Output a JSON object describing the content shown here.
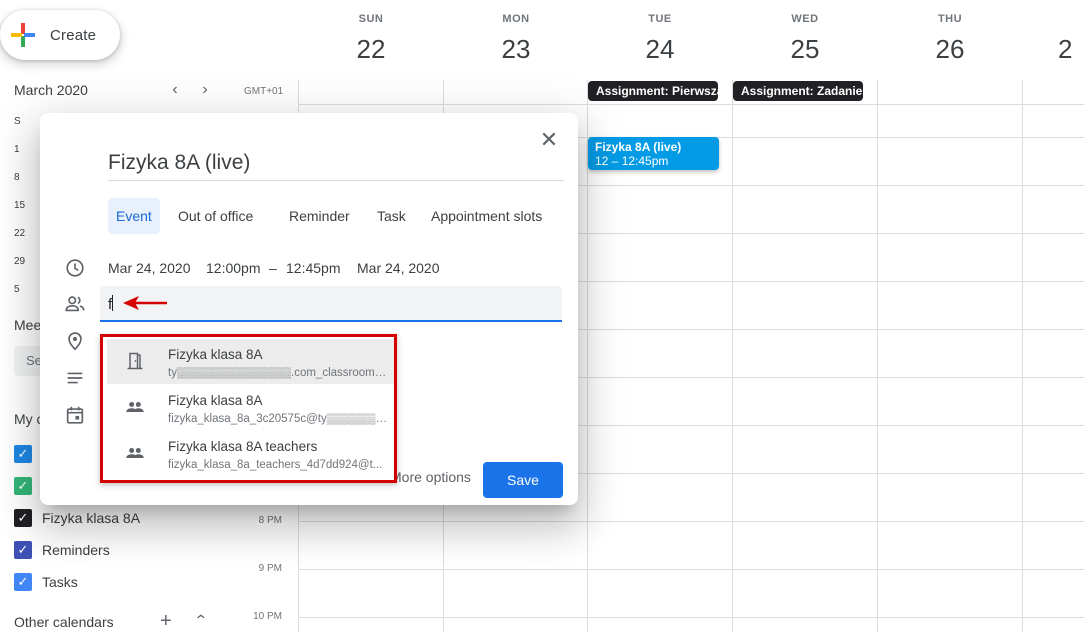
{
  "create": {
    "label": "Create"
  },
  "mini_calendar": {
    "month": "March 2020",
    "weekday_header": "S",
    "rows": [
      "1",
      "8",
      "15",
      "22",
      "29",
      "5"
    ]
  },
  "timezone": "GMT+01",
  "days": [
    {
      "name": "SUN",
      "num": "22"
    },
    {
      "name": "MON",
      "num": "23"
    },
    {
      "name": "TUE",
      "num": "24"
    },
    {
      "name": "WED",
      "num": "25"
    },
    {
      "name": "THU",
      "num": "26"
    }
  ],
  "allday_events": [
    "Assignment: Pierwsza",
    "Assignment: Zadanie"
  ],
  "event": {
    "title": "Fizyka 8A (live)",
    "time": "12 – 12:45pm"
  },
  "time_labels": [
    "8 PM",
    "9 PM",
    "10 PM"
  ],
  "sidebar": {
    "meet_heading": "Mee",
    "search_stub": "Se",
    "my_calendars_heading": "My c",
    "calendars": [
      {
        "label": "",
        "color": "#1e88e5"
      },
      {
        "label": "",
        "color": "#33b679"
      },
      {
        "label": "Fizyka klasa 8A",
        "color": "#202124"
      },
      {
        "label": "Reminders",
        "color": "#3f51b5"
      },
      {
        "label": "Tasks",
        "color": "#4285f4"
      }
    ],
    "other_calendars": "Other calendars"
  },
  "dialog": {
    "title": "Fizyka 8A (live)",
    "tabs": [
      "Event",
      "Out of office",
      "Reminder",
      "Task",
      "Appointment slots"
    ],
    "start_date": "Mar 24, 2020",
    "start_time": "12:00pm",
    "dash": "–",
    "end_time": "12:45pm",
    "end_date": "Mar 24, 2020",
    "guest_input": "f",
    "more_options": "More options",
    "save": "Save"
  },
  "suggestions": [
    {
      "name": "Fizyka klasa 8A",
      "email": "ty▒▒▒▒▒▒▒▒▒▒▒▒▒▒.com_classroom3...",
      "icon": "room-icon"
    },
    {
      "name": "Fizyka klasa 8A",
      "email": "fizyka_klasa_8a_3c20575c@ty▒▒▒▒▒▒ si...",
      "icon": "group-icon"
    },
    {
      "name": "Fizyka klasa 8A teachers",
      "email": "fizyka_klasa_8a_teachers_4d7dd924@t...",
      "icon": "group-icon"
    }
  ],
  "colors": {
    "accent": "#1a73e8",
    "event": "#039be5",
    "highlight_box": "#d50000"
  }
}
